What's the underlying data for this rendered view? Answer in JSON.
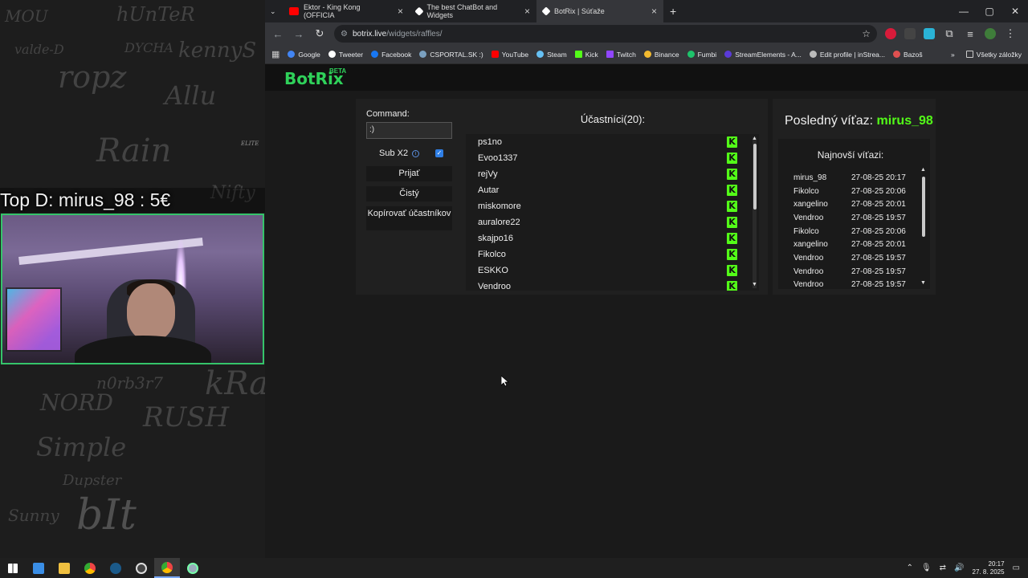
{
  "overlay": {
    "top_donation": "Top D: mirus_98 : 5€",
    "graffiti": [
      "MOU",
      "hUnTeR",
      "valde-D",
      "DYCHA",
      "kennyS",
      "ropz",
      "Allu",
      "Rain",
      "Nifty",
      "RUSH",
      "Simple",
      "Dupster",
      "bIt",
      "Sunny",
      "NORD",
      "n0rb3r7",
      "kRaM",
      "ELITE"
    ]
  },
  "browser": {
    "tabs": [
      {
        "label": "Ektor - King Kong (OFFICIA",
        "color": "#ff0000"
      },
      {
        "label": "The best ChatBot and Widgets",
        "color": "#ffffff"
      },
      {
        "label": "BotRix | Súťaže",
        "color": "#ffffff"
      }
    ],
    "new_tab": "+",
    "window_controls": [
      "—",
      "▢",
      "✕"
    ],
    "url_host": "botrix.live",
    "url_path": "/widgets/raffles/",
    "bookmarks": [
      {
        "label": "Google",
        "color": "#4285f4"
      },
      {
        "label": "Tweeter",
        "color": "#ffffff"
      },
      {
        "label": "Facebook",
        "color": "#1877f2"
      },
      {
        "label": "CSPORTAL.SK :)",
        "color": "#7aa0c0"
      },
      {
        "label": "YouTube",
        "color": "#ff0000"
      },
      {
        "label": "Steam",
        "color": "#66c0f4"
      },
      {
        "label": "Kick",
        "color": "#53fc18"
      },
      {
        "label": "Twitch",
        "color": "#9146ff"
      },
      {
        "label": "Binance",
        "color": "#f3ba2f"
      },
      {
        "label": "Fumbi",
        "color": "#1ec36b"
      },
      {
        "label": "StreamElements - A...",
        "color": "#5a3ad8"
      },
      {
        "label": "Edit profile | inStrea...",
        "color": "#bbbbbb"
      },
      {
        "label": "Bazoš",
        "color": "#e05050"
      }
    ],
    "bookmarks_more": "»",
    "all_bookmarks": "Všetky záložky"
  },
  "app": {
    "logo": "BotRix",
    "beta": "BETA",
    "command_label": "Command:",
    "command_value": ":)",
    "sub_label": "Sub X2",
    "sub_checked": true,
    "buttons": {
      "accept": "Prijať",
      "clear": "Čistý",
      "copy": "Kopírovať účastníkov"
    },
    "participants_title": "Účastníci(20):",
    "participants": [
      "ps1no",
      "Evoo1337",
      "rejVy",
      "Autar",
      "miskomore",
      "auralore22",
      "skajpo16",
      "Fikolco",
      "ESKKO",
      "Vendroo"
    ],
    "last_winner_label": "Posledný víťaz:",
    "last_winner": "mirus_98",
    "recent_title": "Najnovší víťazi:",
    "recent_winners": [
      {
        "name": "mirus_98",
        "date": "27-08-25 20:17"
      },
      {
        "name": "Fikolco",
        "date": "27-08-25 20:06"
      },
      {
        "name": "xangelino",
        "date": "27-08-25 20:01"
      },
      {
        "name": "Vendroo",
        "date": "27-08-25 19:57"
      },
      {
        "name": "Fikolco",
        "date": "27-08-25 20:06"
      },
      {
        "name": "xangelino",
        "date": "27-08-25 20:01"
      },
      {
        "name": "Vendroo",
        "date": "27-08-25 19:57"
      },
      {
        "name": "Vendroo",
        "date": "27-08-25 19:57"
      },
      {
        "name": "Vendroo",
        "date": "27-08-25 19:57"
      }
    ]
  },
  "taskbar": {
    "time": "20:17",
    "date": "27. 8. 2025",
    "apps": [
      "start",
      "search",
      "files",
      "chrome-alt",
      "steam",
      "obs",
      "chrome",
      "app"
    ]
  }
}
